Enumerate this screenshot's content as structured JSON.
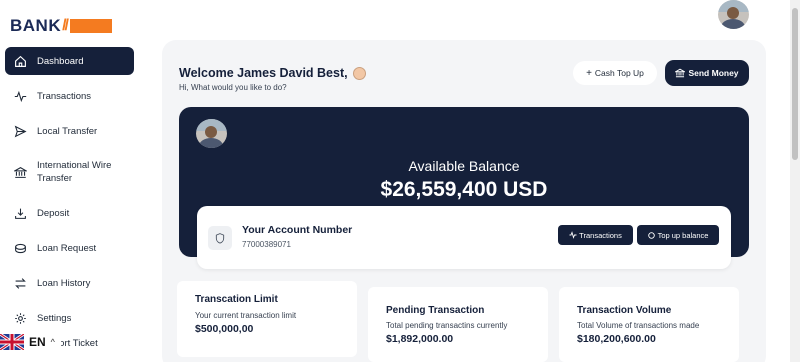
{
  "brand": {
    "name": "BANK",
    "slash": "//",
    "accent_color": "#f47b20",
    "primary_color": "#15203a"
  },
  "sidebar": {
    "items": [
      {
        "label": "Dashboard",
        "icon": "home-icon",
        "active": true
      },
      {
        "label": "Transactions",
        "icon": "activity-icon"
      },
      {
        "label": "Local Transfer",
        "icon": "send-icon"
      },
      {
        "label": "International Wire Transfer",
        "icon": "bank-icon"
      },
      {
        "label": "Deposit",
        "icon": "download-icon"
      },
      {
        "label": "Loan Request",
        "icon": "coins-icon"
      },
      {
        "label": "Loan History",
        "icon": "swap-icon"
      },
      {
        "label": "Settings",
        "icon": "gear-icon"
      },
      {
        "label": "Support Ticket",
        "icon": "ticket-icon"
      }
    ]
  },
  "language": {
    "code": "EN",
    "flag": "uk-flag-icon"
  },
  "header": {
    "welcome": "Welcome James David Best,",
    "subtitle": "Hi, What would you like to do?",
    "cash_top_up": "Cash Top Up",
    "send_money": "Send Money"
  },
  "balance": {
    "label": "Available Balance",
    "amount": "$26,559,400 USD",
    "account_title": "Your Account Number",
    "account_number": "77000389071",
    "transactions_btn": "Transactions",
    "top_up_btn": "Top up balance"
  },
  "stats": [
    {
      "title": "Transcation Limit",
      "subtitle": "Your current transaction limit",
      "value": "$500,000,00"
    },
    {
      "title": "Pending Transaction",
      "subtitle": "Total pending transactins currently",
      "value": "$1,892,000.00"
    },
    {
      "title": "Transaction Volume",
      "subtitle": "Total Volume of transactions made",
      "value": "$180,200,600.00"
    }
  ]
}
